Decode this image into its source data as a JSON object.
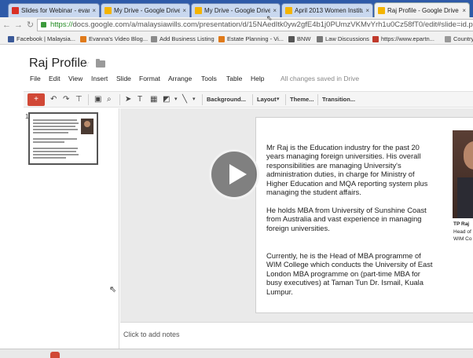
{
  "browser": {
    "tabs": [
      {
        "title": "Slides for Webinar - evan",
        "favicon_color": "#d93025"
      },
      {
        "title": "My Drive - Google Drive",
        "favicon_color": "#f4b400"
      },
      {
        "title": "My Drive - Google Drive",
        "favicon_color": "#f4b400"
      },
      {
        "title": "April 2013 Women Institut",
        "favicon_color": "#f4b400"
      },
      {
        "title": "Raj Profile - Google Drive",
        "favicon_color": "#f4b400"
      }
    ],
    "tab_close_glyph": "×",
    "url_scheme": "https://",
    "url_rest": "docs.google.com/a/malaysiawills.com/presentation/d/15NAedItk0yw2gfE4b1j0PUmzVKMvYrh1u0Cz58fT0/edit#slide=id.p",
    "bookmarks": [
      {
        "label": "Facebook | Malaysia...",
        "icon_color": "#3b5998"
      },
      {
        "label": "Evanna's Video Blog...",
        "icon_color": "#e07a1a"
      },
      {
        "label": "Add Business Listing",
        "icon_color": "#8a8a8a"
      },
      {
        "label": "Estate Planning - Vi...",
        "icon_color": "#e07a1a"
      },
      {
        "label": "BNW",
        "icon_color": "#555555"
      },
      {
        "label": "Law Discussions",
        "icon_color": "#777777"
      },
      {
        "label": "https://www.epartn...",
        "icon_color": "#c0392b"
      },
      {
        "label": "Country",
        "icon_color": "#999999"
      }
    ]
  },
  "doc": {
    "title": "Raj Profile",
    "menu": [
      "File",
      "Edit",
      "View",
      "Insert",
      "Slide",
      "Format",
      "Arrange",
      "Tools",
      "Table",
      "Help"
    ],
    "save_status": "All changes saved in Drive"
  },
  "toolbar": {
    "new_slide": "+",
    "background": "Background...",
    "layout": "Layout",
    "theme": "Theme...",
    "transition": "Transition..."
  },
  "filmstrip": {
    "slide_number": "1"
  },
  "slide": {
    "paragraphs": [
      "Mr Raj is the Education industry for the past 20 years managing foreign universities. His overall responsibilities are managing University's administration duties, in charge for Ministry of Higher Education and MQA reporting system plus managing the student affairs.",
      "He holds MBA from University of Sunshine Coast from Australia and vast experience in managing foreign universities.",
      "Currently, he is the Head of MBA programme of WIM College which conducts the University of East London MBA programme on (part-time MBA for busy executives) at Taman Tun Dr. Ismail, Kuala Lumpur."
    ],
    "caption_name": "TP Raj",
    "caption_line2": "Head of",
    "caption_line3": "WIM Co"
  },
  "notes": {
    "placeholder": "Click to add notes"
  },
  "colors": {
    "tab_strip": "#2e5aa8",
    "new_slide_button": "#d14836",
    "url_secure": "#1f8a1f"
  }
}
